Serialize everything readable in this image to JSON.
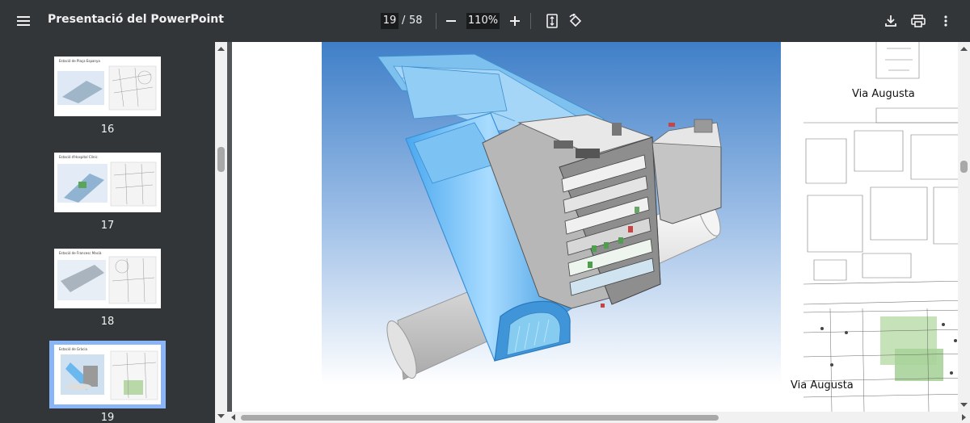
{
  "toolbar": {
    "title": "Presentació del PowerPoint",
    "current_page": "19",
    "page_separator": "/",
    "total_pages": "58",
    "zoom": "110%"
  },
  "sidebar": {
    "thumbnails": [
      {
        "page": "16",
        "caption": "Estació de Plaça Espanya"
      },
      {
        "page": "17",
        "caption": "Estació d'Hospital Clínic"
      },
      {
        "page": "18",
        "caption": "Estació de Francesc Macià"
      },
      {
        "page": "19",
        "caption": "Estació de Gràcia",
        "selected": true
      }
    ]
  },
  "slide": {
    "label_top": "Via Augusta",
    "label_bottom": "Via Augusta"
  },
  "colors": {
    "toolbar_bg": "#323639",
    "viewer_bg": "#525659",
    "selection": "#8ab4f8",
    "tunnel_blue": "#7fc4f5"
  },
  "icons": [
    "menu-icon",
    "zoom-out-icon",
    "zoom-in-icon",
    "fit-page-icon",
    "rotate-icon",
    "download-icon",
    "print-icon",
    "more-icon"
  ]
}
